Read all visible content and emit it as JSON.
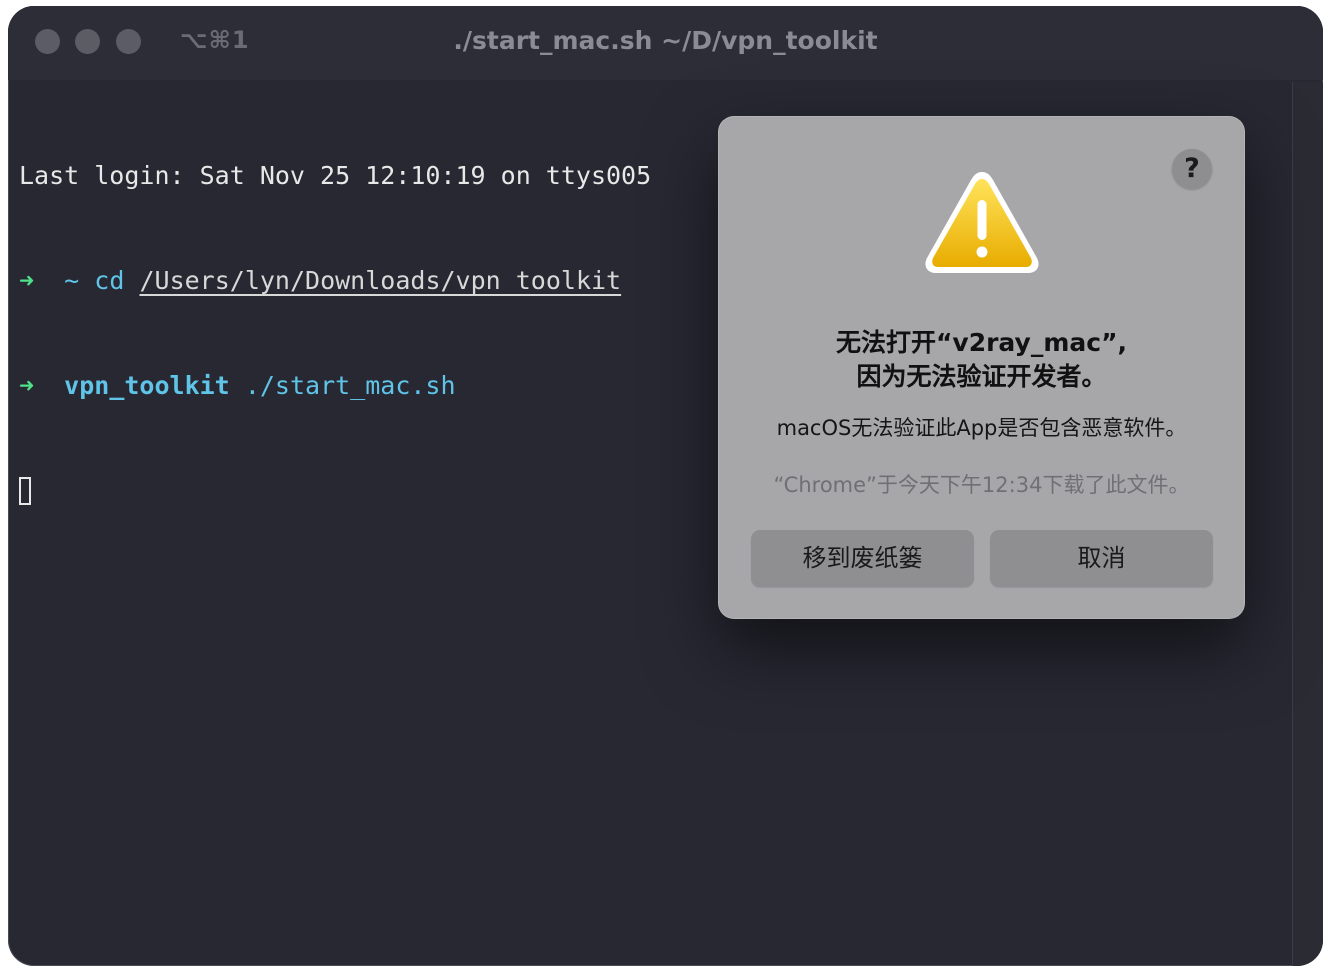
{
  "window": {
    "shortcut": "⌥⌘1",
    "title": "./start_mac.sh ~/D/vpn_toolkit"
  },
  "terminal": {
    "last_login": "Last login: Sat Nov 25 12:10:19 on ttys005",
    "prompt_arrow": "➜",
    "line2_dir": "~",
    "line2_cmd": "cd",
    "line2_path": "/Users/lyn/Downloads/vpn_toolkit",
    "line3_dir": "vpn_toolkit",
    "line3_cmd": "./start_mac.sh"
  },
  "dialog": {
    "help_label": "?",
    "icon": "warning-icon",
    "title_line1": "无法打开“v2ray_mac”,",
    "title_line2": "因为无法验证开发者。",
    "message": "macOS无法验证此App是否包含恶意软件。",
    "download_info": "“Chrome”于今天下午12:34下载了此文件。",
    "trash_button": "移到废纸篓",
    "cancel_button": "取消"
  },
  "colors": {
    "terminal_bg": "#272832",
    "prompt_arrow": "#4fe08a",
    "command_cyan": "#5fc4e8",
    "dialog_bg": "#a7a7aa",
    "warning_yellow": "#f2c200"
  }
}
